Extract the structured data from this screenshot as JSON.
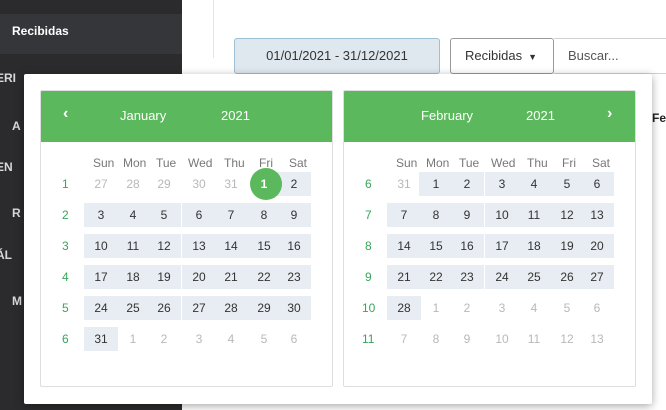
{
  "sidebar": {
    "active_item": "Recibidas",
    "fragments": [
      "ERI",
      "A",
      "EN",
      "R",
      "ÁL",
      "M"
    ]
  },
  "toolbar": {
    "date_range": "01/01/2021 - 31/12/2021",
    "filter_label": "Recibidas",
    "search_placeholder": "Buscar...",
    "column_header_partial": "Fe"
  },
  "datepicker": {
    "prev_icon": "‹",
    "next_icon": "›",
    "weekdays": [
      "Sun",
      "Mon",
      "Tue",
      "Wed",
      "Thu",
      "Fri",
      "Sat"
    ],
    "left": {
      "month": "January",
      "year": "2021",
      "weeks": [
        {
          "num": "1",
          "days": [
            [
              "27",
              "out"
            ],
            [
              "28",
              "out"
            ],
            [
              "29",
              "out"
            ],
            [
              "30",
              "out"
            ],
            [
              "31",
              "out"
            ],
            [
              "1",
              "selected"
            ],
            [
              "2",
              "in"
            ]
          ]
        },
        {
          "num": "2",
          "days": [
            [
              "3",
              "in"
            ],
            [
              "4",
              "in"
            ],
            [
              "5",
              "in"
            ],
            [
              "6",
              "in"
            ],
            [
              "7",
              "in"
            ],
            [
              "8",
              "in"
            ],
            [
              "9",
              "in"
            ]
          ]
        },
        {
          "num": "3",
          "days": [
            [
              "10",
              "in"
            ],
            [
              "11",
              "in"
            ],
            [
              "12",
              "in"
            ],
            [
              "13",
              "in"
            ],
            [
              "14",
              "in"
            ],
            [
              "15",
              "in"
            ],
            [
              "16",
              "in"
            ]
          ]
        },
        {
          "num": "4",
          "days": [
            [
              "17",
              "in"
            ],
            [
              "18",
              "in"
            ],
            [
              "19",
              "in"
            ],
            [
              "20",
              "in"
            ],
            [
              "21",
              "in"
            ],
            [
              "22",
              "in"
            ],
            [
              "23",
              "in"
            ]
          ]
        },
        {
          "num": "5",
          "days": [
            [
              "24",
              "in"
            ],
            [
              "25",
              "in"
            ],
            [
              "26",
              "in"
            ],
            [
              "27",
              "in"
            ],
            [
              "28",
              "in"
            ],
            [
              "29",
              "in"
            ],
            [
              "30",
              "in"
            ]
          ]
        },
        {
          "num": "6",
          "days": [
            [
              "31",
              "in"
            ],
            [
              "1",
              "out"
            ],
            [
              "2",
              "out"
            ],
            [
              "3",
              "out"
            ],
            [
              "4",
              "out"
            ],
            [
              "5",
              "out"
            ],
            [
              "6",
              "out"
            ]
          ]
        }
      ]
    },
    "right": {
      "month": "February",
      "year": "2021",
      "weeks": [
        {
          "num": "6",
          "days": [
            [
              "31",
              "out"
            ],
            [
              "1",
              "in"
            ],
            [
              "2",
              "in"
            ],
            [
              "3",
              "in"
            ],
            [
              "4",
              "in"
            ],
            [
              "5",
              "in"
            ],
            [
              "6",
              "in"
            ]
          ]
        },
        {
          "num": "7",
          "days": [
            [
              "7",
              "in"
            ],
            [
              "8",
              "in"
            ],
            [
              "9",
              "in"
            ],
            [
              "10",
              "in"
            ],
            [
              "11",
              "in"
            ],
            [
              "12",
              "in"
            ],
            [
              "13",
              "in"
            ]
          ]
        },
        {
          "num": "8",
          "days": [
            [
              "14",
              "in"
            ],
            [
              "15",
              "in"
            ],
            [
              "16",
              "in"
            ],
            [
              "17",
              "in"
            ],
            [
              "18",
              "in"
            ],
            [
              "19",
              "in"
            ],
            [
              "20",
              "in"
            ]
          ]
        },
        {
          "num": "9",
          "days": [
            [
              "21",
              "in"
            ],
            [
              "22",
              "in"
            ],
            [
              "23",
              "in"
            ],
            [
              "24",
              "in"
            ],
            [
              "25",
              "in"
            ],
            [
              "26",
              "in"
            ],
            [
              "27",
              "in"
            ]
          ]
        },
        {
          "num": "10",
          "days": [
            [
              "28",
              "in"
            ],
            [
              "1",
              "out"
            ],
            [
              "2",
              "out"
            ],
            [
              "3",
              "out"
            ],
            [
              "4",
              "out"
            ],
            [
              "5",
              "out"
            ],
            [
              "6",
              "out"
            ]
          ]
        },
        {
          "num": "11",
          "days": [
            [
              "7",
              "out"
            ],
            [
              "8",
              "out"
            ],
            [
              "9",
              "out"
            ],
            [
              "10",
              "out"
            ],
            [
              "11",
              "out"
            ],
            [
              "12",
              "out"
            ],
            [
              "13",
              "out"
            ]
          ]
        }
      ]
    }
  }
}
